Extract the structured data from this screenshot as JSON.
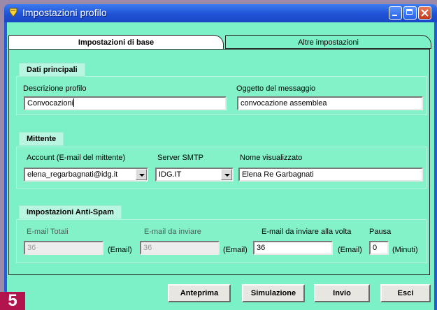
{
  "window": {
    "title": "Impostazioni profilo"
  },
  "tabs": [
    {
      "label": "Impostazioni di base",
      "active": true
    },
    {
      "label": "Altre impostazioni",
      "active": false
    }
  ],
  "dati_principali": {
    "header": "Dati principali",
    "descrizione_label": "Descrizione profilo",
    "descrizione_value": "Convocazioni",
    "oggetto_label": "Oggetto del messaggio",
    "oggetto_value": "convocazione assemblea"
  },
  "mittente": {
    "header": "Mittente",
    "account_label": "Account (E-mail del mittente)",
    "account_value": "elena_regarbagnati@idg.it",
    "smtp_label": "Server SMTP",
    "smtp_value": "IDG.IT",
    "nome_label": "Nome visualizzato",
    "nome_value": "Elena Re Garbagnati"
  },
  "antispam": {
    "header": "Impostazioni Anti-Spam",
    "totali_label": "E-mail Totali",
    "totali_value": "36",
    "da_inviare_label": "E-mail da inviare",
    "da_inviare_value": "36",
    "alla_volta_label": "E-mail da inviare alla volta",
    "alla_volta_value": "36",
    "pausa_label": "Pausa",
    "pausa_value": "0",
    "unit_email": "(Email)",
    "unit_minuti": "(Minuti)"
  },
  "buttons": {
    "anteprima": "Anteprima",
    "simulazione": "Simulazione",
    "invio": "Invio",
    "esci": "Esci"
  },
  "badge": "5",
  "colors": {
    "titlebar": "#1f52d6",
    "client": "#7cf0c6",
    "badge": "#b2154e"
  }
}
